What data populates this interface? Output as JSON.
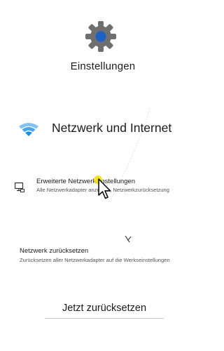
{
  "app": {
    "title": "Einstellungen",
    "icon": "gear-icon"
  },
  "section": {
    "title": "Netzwerk und Internet",
    "icon": "wifi-icon"
  },
  "advanced_settings_item": {
    "label": "Erweiterte Netzwerkeinstellungen",
    "description": "Alle Netzwerkadapter anzeigen, Netzwerkzurücksetzung",
    "icon": "pc-network-icon"
  },
  "network_reset": {
    "title": "Netzwerk zurücksetzen",
    "description": "Zurücksetzen aller Netzwerkadapter auf die Werkseinstellungen",
    "button_label": "Jetzt zurücksetzen"
  },
  "colors": {
    "gear_body": "#6f6f6f",
    "gear_center": "#1b62c4",
    "wifi": "#1a8fe6",
    "cursor_highlight": "#f2e218"
  }
}
